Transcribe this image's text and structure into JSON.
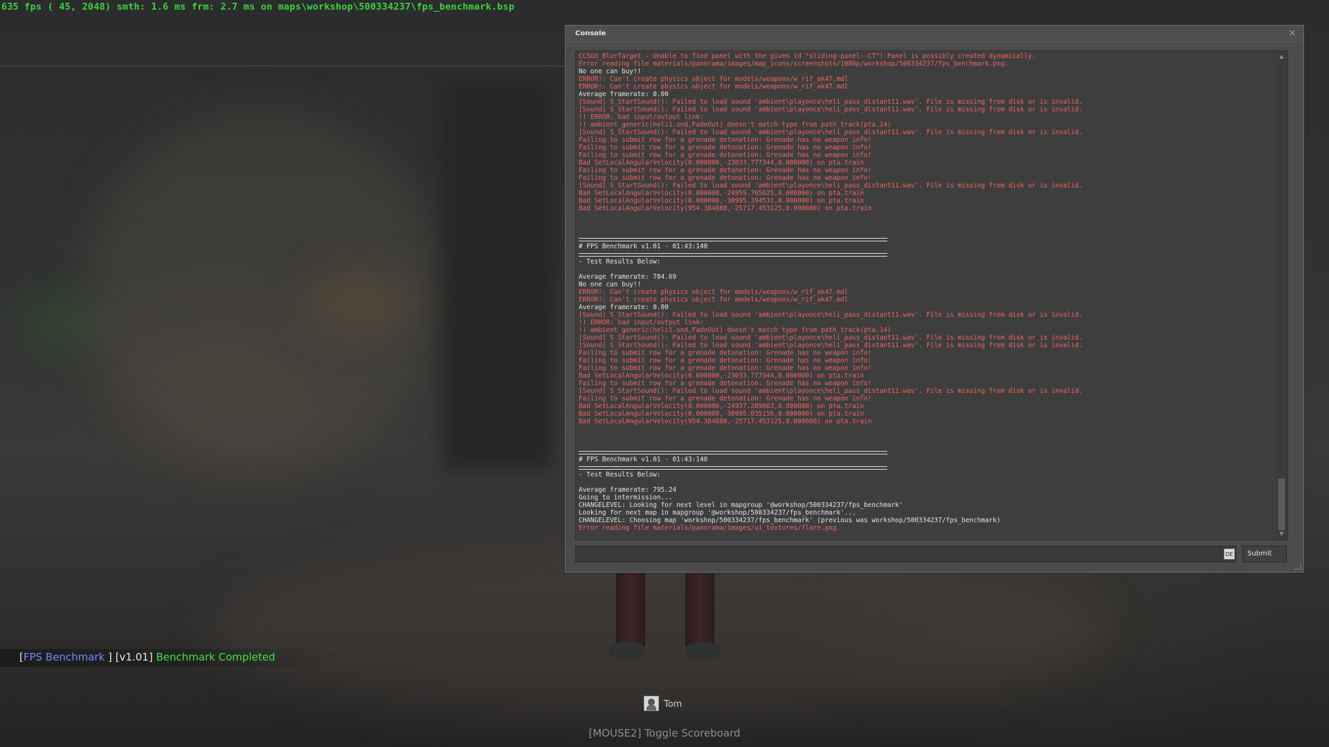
{
  "hud": {
    "fps_line": "635 fps ( 45, 2048) smth: 1.6 ms frm: 2.7 ms on maps\\workshop\\500334237\\fps_benchmark.bsp"
  },
  "console": {
    "title": "Console",
    "close_icon": "×",
    "submit_label": "Submit",
    "input_value": "",
    "lang_badge": "DE",
    "lines": [
      {
        "t": "CCSGO_BlurTarget - Unable to find panel with the given id \"sliding-panel--CT\"! Panel is possibly created dynamically.",
        "c": "err"
      },
      {
        "t": "Error reading file materials/panorama/images/map_icons/screenshots/1080p/workshop/500334237/fps_benchmark.png.",
        "c": "err"
      },
      {
        "t": "No one can buy!!",
        "c": "norm"
      },
      {
        "t": "ERROR!: Can't create physics object for models/weapons/w_rif_ak47.mdl",
        "c": "err"
      },
      {
        "t": "ERROR!: Can't create physics object for models/weapons/w_rif_ak47.mdl",
        "c": "err"
      },
      {
        "t": "Average framerate: 0.00",
        "c": "norm"
      },
      {
        "t": "[Sound] S_StartSound(): Failed to load sound 'ambient\\playonce\\heli_pass_distant11.wav'. File is missing from disk or is invalid.",
        "c": "err"
      },
      {
        "t": "[Sound] S_StartSound(): Failed to load sound 'ambient\\playonce\\heli_pass_distant11.wav'. File is missing from disk or is invalid.",
        "c": "err"
      },
      {
        "t": "!! ERROR: bad input/output link:",
        "c": "err"
      },
      {
        "t": "!! ambient_generic(heli1.snd,FadeOut) doesn't match type from path_track(pta.14)",
        "c": "err"
      },
      {
        "t": "[Sound] S_StartSound(): Failed to load sound 'ambient\\playonce\\heli_pass_distant11.wav'. File is missing from disk or is invalid.",
        "c": "err"
      },
      {
        "t": "Failing to submit row for a grenade detonation: Grenade has no weapon info!",
        "c": "err"
      },
      {
        "t": "Failing to submit row for a grenade detonation: Grenade has no weapon info!",
        "c": "err"
      },
      {
        "t": "Failing to submit row for a grenade detonation: Grenade has no weapon info!",
        "c": "err"
      },
      {
        "t": "Bad SetLocalAngularVelocity(0.000000,-23033.777344,0.000000) on pta.train",
        "c": "err"
      },
      {
        "t": "Failing to submit row for a grenade detonation: Grenade has no weapon info!",
        "c": "err"
      },
      {
        "t": "Failing to submit row for a grenade detonation: Grenade has no weapon info!",
        "c": "err"
      },
      {
        "t": "[Sound] S_StartSound(): Failed to load sound 'ambient\\playonce\\heli_pass_distant11.wav'. File is missing from disk or is invalid.",
        "c": "err"
      },
      {
        "t": "Bad SetLocalAngularVelocity(0.000000,-24959.765625,0.000000) on pta.train",
        "c": "err"
      },
      {
        "t": "Bad SetLocalAngularVelocity(0.000000,-30995.394531,0.000000) on pta.train",
        "c": "err"
      },
      {
        "t": "Bad SetLocalAngularVelocity(954.384888,-25717.453125,0.000000) on pta.train",
        "c": "err"
      },
      {
        "t": "",
        "c": "blank"
      },
      {
        "t": "",
        "c": "blank"
      },
      {
        "t": "",
        "c": "blank"
      },
      {
        "t": "",
        "c": "sep"
      },
      {
        "t": "# FPS Benchmark v1.01 - 01:43:140",
        "c": "norm"
      },
      {
        "t": "",
        "c": "sep"
      },
      {
        "t": "- Test Results Below:",
        "c": "norm"
      },
      {
        "t": "",
        "c": "blank"
      },
      {
        "t": "Average framerate: 784.69",
        "c": "norm"
      },
      {
        "t": "No one can buy!!",
        "c": "norm"
      },
      {
        "t": "ERROR!: Can't create physics object for models/weapons/w_rif_ak47.mdl",
        "c": "err"
      },
      {
        "t": "ERROR!: Can't create physics object for models/weapons/w_rif_ak47.mdl",
        "c": "err"
      },
      {
        "t": "Average framerate: 0.00",
        "c": "norm"
      },
      {
        "t": "[Sound] S_StartSound(): Failed to load sound 'ambient\\playonce\\heli_pass_distant11.wav'. File is missing from disk or is invalid.",
        "c": "err"
      },
      {
        "t": "!! ERROR: bad input/output link:",
        "c": "err"
      },
      {
        "t": "!! ambient_generic(heli1.snd,FadeOut) doesn't match type from path_track(pta.14)",
        "c": "err"
      },
      {
        "t": "[Sound] S_StartSound(): Failed to load sound 'ambient\\playonce\\heli_pass_distant11.wav'. File is missing from disk or is invalid.",
        "c": "err"
      },
      {
        "t": "[Sound] S_StartSound(): Failed to load sound 'ambient\\playonce\\heli_pass_distant11.wav'. File is missing from disk or is invalid.",
        "c": "err"
      },
      {
        "t": "Failing to submit row for a grenade detonation: Grenade has no weapon info!",
        "c": "err"
      },
      {
        "t": "Failing to submit row for a grenade detonation: Grenade has no weapon info!",
        "c": "err"
      },
      {
        "t": "Failing to submit row for a grenade detonation: Grenade has no weapon info!",
        "c": "err"
      },
      {
        "t": "Bad SetLocalAngularVelocity(0.000000,-23033.777344,0.000000) on pta.train",
        "c": "err"
      },
      {
        "t": "Failing to submit row for a grenade detonation: Grenade has no weapon info!",
        "c": "err"
      },
      {
        "t": "[Sound] S_StartSound(): Failed to load sound 'ambient\\playonce\\heli_pass_distant11.wav'. File is missing from disk or is invalid.",
        "c": "err"
      },
      {
        "t": "Failing to submit row for a grenade detonation: Grenade has no weapon info!",
        "c": "err"
      },
      {
        "t": "Bad SetLocalAngularVelocity(0.000000,-24937.289063,0.000000) on pta.train",
        "c": "err"
      },
      {
        "t": "Bad SetLocalAngularVelocity(0.000000,-30995.035156,0.000000) on pta.train",
        "c": "err"
      },
      {
        "t": "Bad SetLocalAngularVelocity(954.384888,-25717.453125,0.000000) on pta.train",
        "c": "err"
      },
      {
        "t": "",
        "c": "blank"
      },
      {
        "t": "",
        "c": "blank"
      },
      {
        "t": "",
        "c": "blank"
      },
      {
        "t": "",
        "c": "sep"
      },
      {
        "t": "# FPS Benchmark v1.01 - 01:43:140",
        "c": "norm"
      },
      {
        "t": "",
        "c": "sep"
      },
      {
        "t": "- Test Results Below:",
        "c": "norm"
      },
      {
        "t": "",
        "c": "blank"
      },
      {
        "t": "Average framerate: 795.24",
        "c": "norm"
      },
      {
        "t": "Going to intermission...",
        "c": "norm"
      },
      {
        "t": "CHANGELEVEL: Looking for next level in mapgroup '@workshop/500334237/fps_benchmark'",
        "c": "norm"
      },
      {
        "t": "Looking for next map in mapgroup '@workshop/500334237/fps_benchmark'...",
        "c": "norm"
      },
      {
        "t": "CHANGELEVEL: Choosing map 'workshop/500334237/fps_benchmark' (previous was workshop/500334237/fps_benchmark)",
        "c": "norm"
      },
      {
        "t": "Error reading file materials/panorama/images/ui_textures/flare.png.",
        "c": "err"
      }
    ]
  },
  "benchmark": {
    "bracket_open": "[",
    "name": "FPS Benchmark",
    "bracket_close": "]",
    "version": "[v1.01]",
    "status": "Benchmark Completed",
    "name_color": "#6d8cff",
    "status_color": "#3fe43f"
  },
  "player": {
    "name": "Tom"
  },
  "scoreboard_hint": "[MOUSE2] Toggle Scoreboard"
}
